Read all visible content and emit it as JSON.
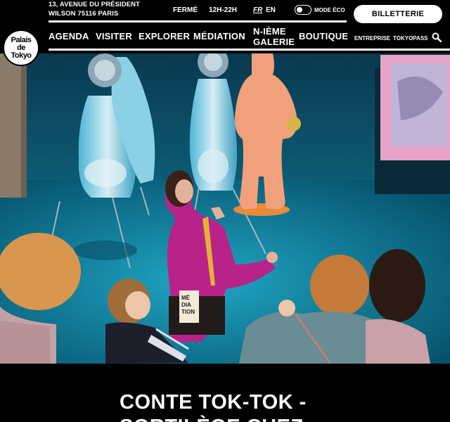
{
  "header": {
    "address": [
      "13, AVENUE DU PRÉSIDENT",
      "WILSON 75116 PARIS"
    ],
    "status": "FERMÉ",
    "hours": "12H-22H",
    "lang_fr": "FR",
    "lang_en": "EN",
    "eco_mode": "MODE ÉCO",
    "ticket_button": "BILLETTERIE",
    "logo": [
      "Palais",
      "de",
      "Tokyo"
    ]
  },
  "nav": {
    "agenda": "AGENDA",
    "visiter": "VISITER",
    "explorer": "EXPLORER",
    "mediation": "MÉDIATION",
    "galerie": [
      "N-IÈME",
      "GALERIE"
    ],
    "boutique": "BOUTIQUE",
    "entreprise": "ENTREPRISE",
    "tokyopass": "TOKYOPASS"
  },
  "hero": {
    "badge": [
      "MÉ",
      "DIA",
      "TION"
    ]
  },
  "page": {
    "title_line1": "CONTE TOK-TOK -",
    "title_line2": "SORTILÈGE CHEZ"
  },
  "colors": {
    "background": "#000000",
    "text": "#ffffff",
    "floor": "#0b7a97",
    "sweater": "#b8238a"
  }
}
